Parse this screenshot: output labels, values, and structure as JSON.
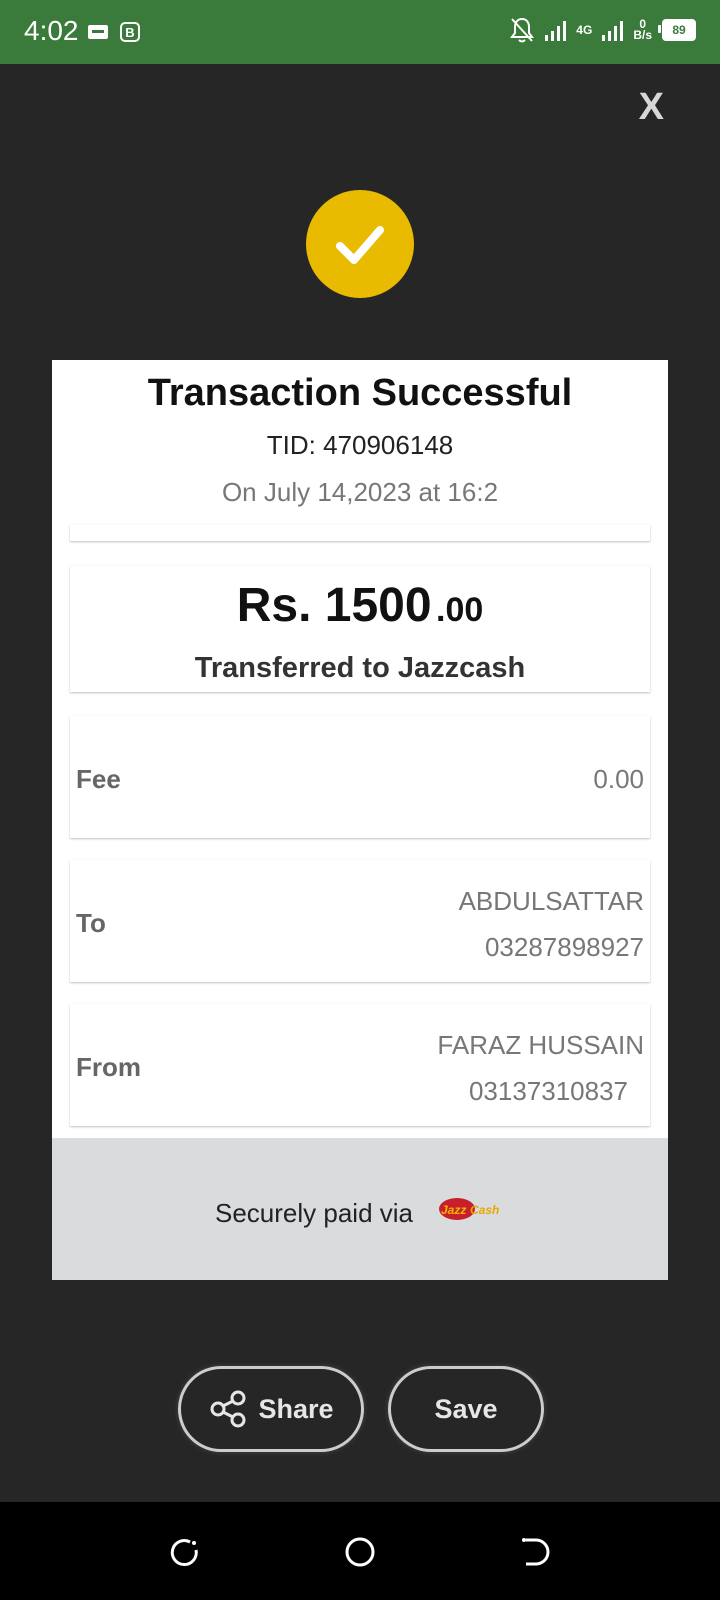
{
  "status_bar": {
    "time": "4:02",
    "app_badge": "B",
    "network": "4G",
    "speed_value": "0",
    "speed_unit": "B/s",
    "battery": "89"
  },
  "close_label": "X",
  "receipt": {
    "title": "Transaction Successful",
    "tid": "TID: 470906148",
    "date": "On July  14,2023 at 16:2",
    "amount_main": "Rs. 1500",
    "amount_decimal": ".00",
    "amount_caption": "Transferred to Jazzcash",
    "fee_label": "Fee",
    "fee_value": "0.00",
    "to_label": "To",
    "to_name": "ABDULSATTAR",
    "to_number": "03287898927",
    "from_label": "From",
    "from_name": "FARAZ HUSSAIN",
    "from_number": "03137310837",
    "secure_text": "Securely paid via",
    "logo_text_red": "Jazz",
    "logo_text_gold": "Cash"
  },
  "actions": {
    "share_label": "Share",
    "save_label": "Save"
  },
  "colors": {
    "status_bar": "#3a7a3b",
    "background": "#262626",
    "badge": "#e8bb00",
    "footer": "#dadbdc"
  }
}
